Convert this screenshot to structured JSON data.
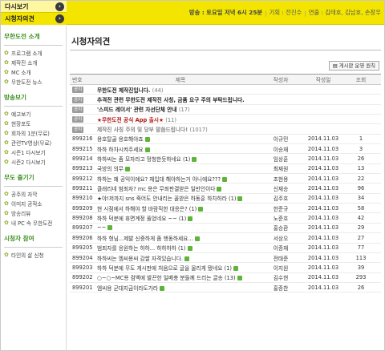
{
  "tabs": {
    "rerun": "다시보기",
    "viewer_opinion": "시청자의견"
  },
  "broadcast": {
    "airtime": "방송 : 토요일 저녁 6시 25분",
    "planning_label": "기획 : 전진수",
    "cast_label": "연출 : 김태호, 김남호, 손창우"
  },
  "sidebar": {
    "sections": [
      {
        "title": "무한도전 소개",
        "items": [
          "프로그램 소개",
          "제작진 소개",
          "MC 소개",
          "무한도전 뉴스"
        ]
      },
      {
        "title": "방송보기",
        "items": [
          "예고보기",
          "현장포토",
          "회차의 1분(무료)",
          "관련TV영상(무료)",
          "시즌1 다시보기",
          "시즌2 다시보기"
        ]
      },
      {
        "title": "무도 즐기기",
        "items": [
          "공주의 자막",
          "이미지 공작소",
          "방송리뷰",
          "내 PC 속 무한도전"
        ]
      },
      {
        "title": "시청자 참여",
        "items": [
          "타인의 삶 신청"
        ]
      }
    ]
  },
  "main": {
    "title": "시청자의견",
    "notice_button": "게시판 운영 원칙",
    "columns": {
      "no": "번호",
      "title": "제목",
      "author": "작성자",
      "date": "작성일",
      "views": "조회"
    },
    "notice_badge": "공지",
    "notices": [
      {
        "title": "무한도전 제작진입니다.",
        "count": "(44)",
        "style": "normal"
      },
      {
        "title": "추격전 관련 무한도전 제작진 사칭, 금품 요구 주의 부탁드립니다.",
        "count": "",
        "style": "normal"
      },
      {
        "title": "'스피드 레이서' 관련 자선단체 안내",
        "count": "(17)",
        "style": "normal"
      },
      {
        "title": "★무한도전 공식 App 출시★",
        "count": "(11)",
        "style": "red"
      },
      {
        "title": "제작진 사칭 주의 및 당부 말씀드립니다!",
        "count": "(1017)",
        "style": "gray"
      }
    ],
    "rows": [
      {
        "no": "899216",
        "title": "용호탈골 용호해야죠",
        "author": "이규민",
        "date": "2014.11.03",
        "views": "1"
      },
      {
        "no": "899215",
        "title": "하하 하차시켜주세요",
        "author": "이승재",
        "date": "2014.11.03",
        "views": "3"
      },
      {
        "no": "899214",
        "title": "하하씨는 좀 모자라고 멍청한듯하네요 (1)",
        "author": "임상훈",
        "date": "2014.11.03",
        "views": "26"
      },
      {
        "no": "899213",
        "title": "국방의 의무",
        "author": "최재원",
        "date": "2014.11.03",
        "views": "13"
      },
      {
        "no": "899212",
        "title": "하하는 왜 공익이에요? 재입대 해야하는거 아니에요???",
        "author": "조현용",
        "date": "2014.11.03",
        "views": "22"
      },
      {
        "no": "899211",
        "title": "클래리네 범죄자? mc 용은 무죄판결받은 일반인이다",
        "author": "신재승",
        "date": "2014.11.03",
        "views": "96"
      },
      {
        "no": "899210",
        "title": "★야!저까지 sns 죽어도 안내리는 꼴받은 하동훈 하차하라 (1)",
        "author": "김주호",
        "date": "2014.11.03",
        "views": "34"
      },
      {
        "no": "899209",
        "title": "현 시점에서 하해야 할 바람직한 대응은? (1)",
        "author": "한준규",
        "date": "2014.11.03",
        "views": "58"
      },
      {
        "no": "899208",
        "title": "하하 덕분에 휴면계정 풀었네요 ~~ (1)",
        "author": "노준호",
        "date": "2014.11.03",
        "views": "42"
      },
      {
        "no": "899207",
        "title": "~~",
        "author": "홍승환",
        "date": "2014.11.03",
        "views": "29"
      },
      {
        "no": "899206",
        "title": "하하 형님...제발 신중하게 좀 행동하세요...",
        "author": "서상오",
        "date": "2014.11.03",
        "views": "27"
      },
      {
        "no": "899205",
        "title": "범죄자를 응원하는 하하... 하하하하 (1)",
        "author": "이종재",
        "date": "2014.11.03",
        "views": "77"
      },
      {
        "no": "899204",
        "title": "하하씨는 엠씨용씨 감쌀 자격있습니다.",
        "author": "전태준",
        "date": "2014.11.03",
        "views": "113"
      },
      {
        "no": "899203",
        "title": "하하 덕분에 무도 게시판에 처음으로 글을 올리게 됐네요 (1)",
        "author": "이지원",
        "date": "2014.11.03",
        "views": "39"
      },
      {
        "no": "899202",
        "title": "○~○~MC용 컴백에 발끈한 일베충 분들께 드리는 글송 (13)",
        "author": "김수현",
        "date": "2014.11.03",
        "views": "293"
      },
      {
        "no": "899201",
        "title": "엠씨용 군대지금이라도가라",
        "author": "홍종찬",
        "date": "2014.11.03",
        "views": "26"
      }
    ]
  }
}
